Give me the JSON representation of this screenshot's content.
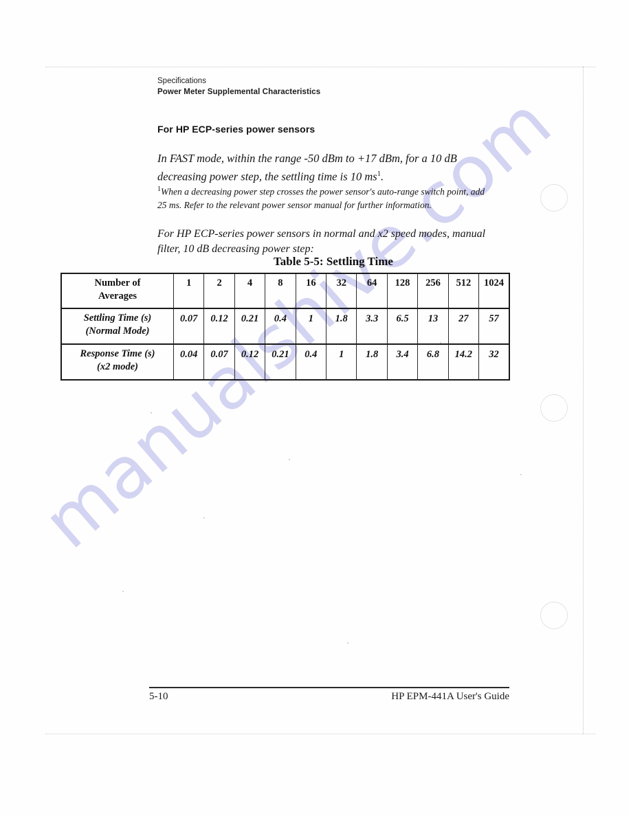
{
  "document": {
    "running_head_line1": "Specifications",
    "running_head_line2": "Power Meter Supplemental Characteristics",
    "section_heading": "For HP ECP-series power sensors",
    "paragraph_main_before_sup": "In FAST mode, within the range -50 dBm to +17 dBm, for a 10 dB decreasing power step, the settling time is 10 ms",
    "paragraph_main_sup": "1",
    "paragraph_main_after_sup": ".",
    "footnote_marker": "1",
    "footnote_text": "When a decreasing power step crosses the power sensor's auto-range switch point, add 25 ms. Refer to the relevant power sensor manual for further information.",
    "paragraph_intro": "For HP ECP-series power sensors in normal and x2 speed modes, manual filter, 10 dB decreasing power step:",
    "table_caption": "Table 5-5:  Settling Time",
    "watermark": "manualshive.com"
  },
  "table": {
    "row_labels": [
      {
        "line1": "Number of",
        "line2": "Averages"
      },
      {
        "line1": "Settling Time (s)",
        "line2": "(Normal Mode)"
      },
      {
        "line1": "Response Time (s)",
        "line2": "(x2 mode)"
      }
    ],
    "averages": [
      "1",
      "2",
      "4",
      "8",
      "16",
      "32",
      "64",
      "128",
      "256",
      "512",
      "1024"
    ],
    "settling_time_normal_mode": [
      "0.07",
      "0.12",
      "0.21",
      "0.4",
      "1",
      "1.8",
      "3.3",
      "6.5",
      "13",
      "27",
      "57"
    ],
    "response_time_x2_mode": [
      "0.04",
      "0.07",
      "0.12",
      "0.21",
      "0.4",
      "1",
      "1.8",
      "3.4",
      "6.8",
      "14.2",
      "32"
    ]
  },
  "footer": {
    "page_number": "5-10",
    "guide_title": "HP EPM-441A User's Guide"
  },
  "chart_data": {
    "type": "table",
    "title": "Table 5-5:  Settling Time",
    "categories": [
      "1",
      "2",
      "4",
      "8",
      "16",
      "32",
      "64",
      "128",
      "256",
      "512",
      "1024"
    ],
    "xlabel": "Number of Averages",
    "ylabel": "Time (s)",
    "series": [
      {
        "name": "Settling Time (s) (Normal Mode)",
        "values": [
          0.07,
          0.12,
          0.21,
          0.4,
          1,
          1.8,
          3.3,
          6.5,
          13,
          27,
          57
        ]
      },
      {
        "name": "Response Time (s) (x2 mode)",
        "values": [
          0.04,
          0.07,
          0.12,
          0.21,
          0.4,
          1,
          1.8,
          3.4,
          6.8,
          14.2,
          32
        ]
      }
    ]
  }
}
